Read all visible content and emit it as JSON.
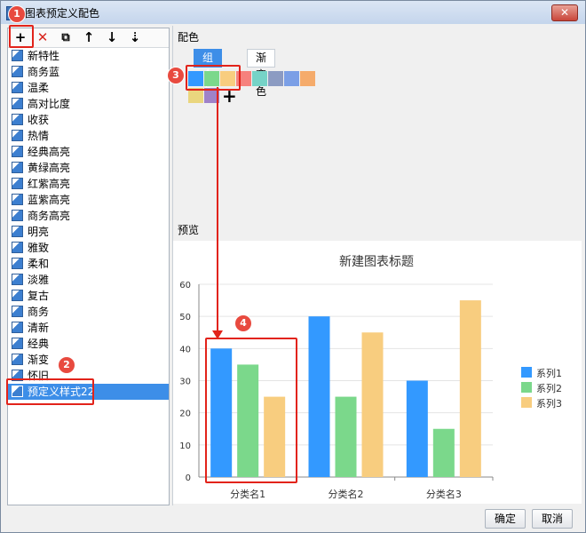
{
  "window": {
    "title": "图表预定义配色",
    "close_glyph": "✕"
  },
  "toolbar": {
    "add": "+",
    "delete": "✕",
    "copy": "⧉",
    "up": "↑",
    "down": "↓",
    "sort": "⇣"
  },
  "styles": [
    "新特性",
    "商务蓝",
    "温柔",
    "高对比度",
    "收获",
    "热情",
    "经典高亮",
    "黄绿高亮",
    "红紫高亮",
    "蓝紫高亮",
    "商务高亮",
    "明亮",
    "雅致",
    "柔和",
    "淡雅",
    "复古",
    "商务",
    "清新",
    "经典",
    "渐变",
    "怀旧",
    "预定义样式22"
  ],
  "selected_style": "预定义样式22",
  "color_section": {
    "label": "配色",
    "tabs": [
      "组合色",
      "渐变色"
    ],
    "active_tab": "组合色",
    "swatches": [
      "#3399ff",
      "#7bd88b",
      "#f8cd7f",
      "#f6817d",
      "#76d3c7",
      "#8c9bc2",
      "#7b9fe6",
      "#f5ab6b",
      "#ead67e",
      "#9f82c8"
    ],
    "add_glyph": "+"
  },
  "preview": {
    "label": "预览",
    "chart_data": {
      "type": "bar",
      "title": "新建图表标题",
      "categories": [
        "分类名1",
        "分类名2",
        "分类名3"
      ],
      "series": [
        {
          "name": "系列1",
          "values": [
            40,
            50,
            30
          ],
          "color": "#3399ff"
        },
        {
          "name": "系列2",
          "values": [
            35,
            25,
            15
          ],
          "color": "#7bd88b"
        },
        {
          "name": "系列3",
          "values": [
            25,
            45,
            55
          ],
          "color": "#f8cd7f"
        }
      ],
      "ylim": [
        0,
        60
      ],
      "yticks": [
        "0",
        "10",
        "20",
        "30",
        "40",
        "50",
        "60"
      ],
      "grid": true,
      "legend_position": "right"
    }
  },
  "callouts": [
    "1",
    "2",
    "3",
    "4"
  ],
  "buttons": {
    "ok": "确定",
    "cancel": "取消"
  }
}
